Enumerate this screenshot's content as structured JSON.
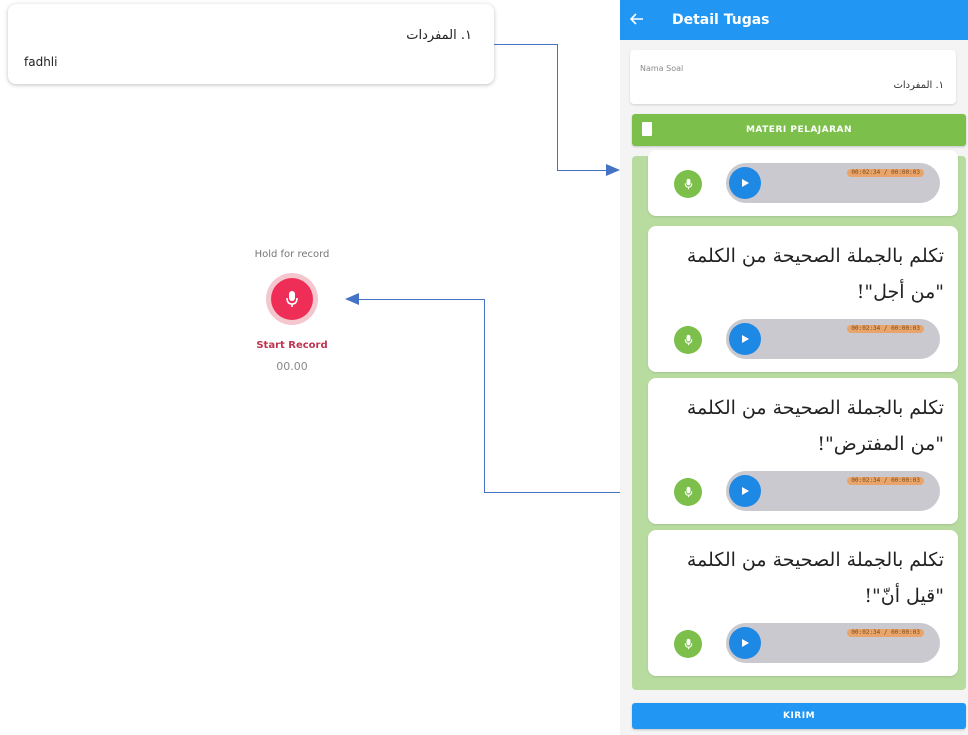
{
  "item_card": {
    "title": "١. المفردات",
    "student": "fadhli"
  },
  "recorder": {
    "hint": "Hold for record",
    "label": "Start Record",
    "time": "00.00"
  },
  "app": {
    "back_icon": "arrow-left-icon",
    "title": "Detail Tugas",
    "soal": {
      "label": "Nama Soal",
      "value": "١. المفردات"
    },
    "materi_button": "MATERI PELAJARAN",
    "questions": [
      {
        "text": "",
        "duration": "00:02:34 / 00:00:03"
      },
      {
        "text": "تكلم بالجملة الصحيحة من الكلمة \"من أجل\"!",
        "duration": "00:02:34 / 00:00:03"
      },
      {
        "text": "تكلم بالجملة الصحيحة من الكلمة \"من المفترض\"!",
        "duration": "00:02:34 / 00:00:03"
      },
      {
        "text": "تكلم بالجملة الصحيحة من الكلمة \"قيل أنّ\"!",
        "duration": "00:02:34 / 00:00:03"
      }
    ],
    "submit_button": "KIRIM"
  },
  "colors": {
    "primary": "#2196f3",
    "green": "#7cc04b",
    "record": "#ee2e56",
    "connector": "#4472c4"
  }
}
